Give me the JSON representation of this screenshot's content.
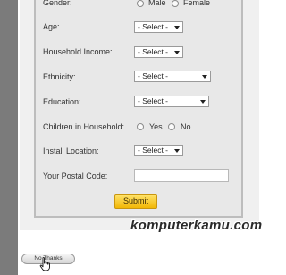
{
  "form": {
    "gender": {
      "label": "Gender:",
      "options": [
        "Male",
        "Female"
      ]
    },
    "age": {
      "label": "Age:",
      "value": "- Select -"
    },
    "household_income": {
      "label": "Household Income:",
      "value": "- Select -"
    },
    "ethnicity": {
      "label": "Ethnicity:",
      "value": "- Select -"
    },
    "education": {
      "label": "Education:",
      "value": "- Select -"
    },
    "children": {
      "label": "Children in Household:",
      "options": [
        "Yes",
        "No"
      ]
    },
    "install_location": {
      "label": "Install Location:",
      "value": "- Select -"
    },
    "postal_code": {
      "label": "Your Postal Code:",
      "value": ""
    },
    "submit_label": "Submit"
  },
  "no_thanks_label": "No Thanks",
  "watermark": "komputerkamu.com",
  "icons": {
    "radio": "radio-button-icon",
    "arrow": "chevron-down-icon",
    "cursor": "hand-pointer-icon"
  }
}
